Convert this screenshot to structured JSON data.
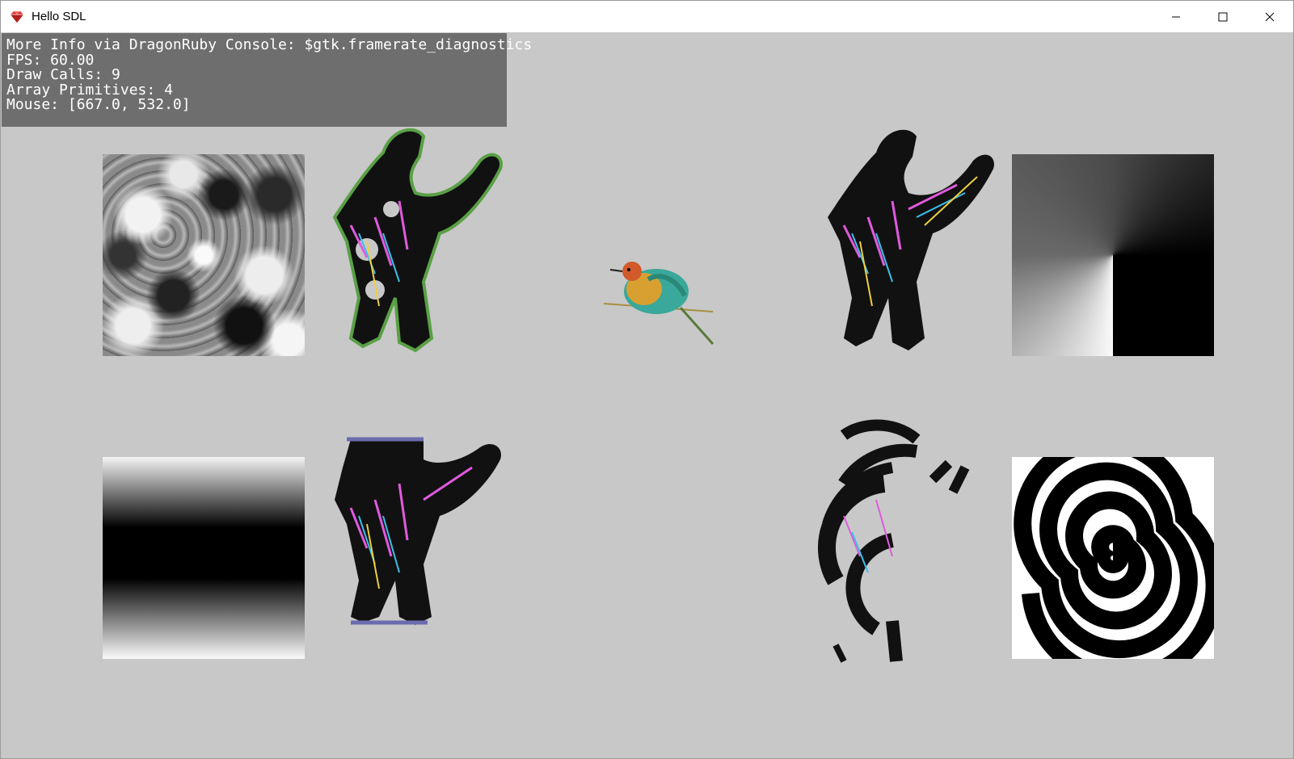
{
  "window": {
    "title": "Hello SDL",
    "icon": "dragonruby-gem-icon",
    "controls": [
      "minimize-icon",
      "maximize-icon",
      "close-icon"
    ]
  },
  "diagnostics": {
    "line1": "More Info via DragonRuby Console: $gtk.framerate_diagnostics",
    "line2": "FPS: 60.00",
    "line3": "Draw Calls: 9",
    "line4": "Array Primitives: 4",
    "line5": "Mouse: [667.0, 532.0]"
  },
  "colors": {
    "background": "#c8c8c8",
    "overlay": "#6e6e6e",
    "overlay_text": "#ffffff"
  }
}
